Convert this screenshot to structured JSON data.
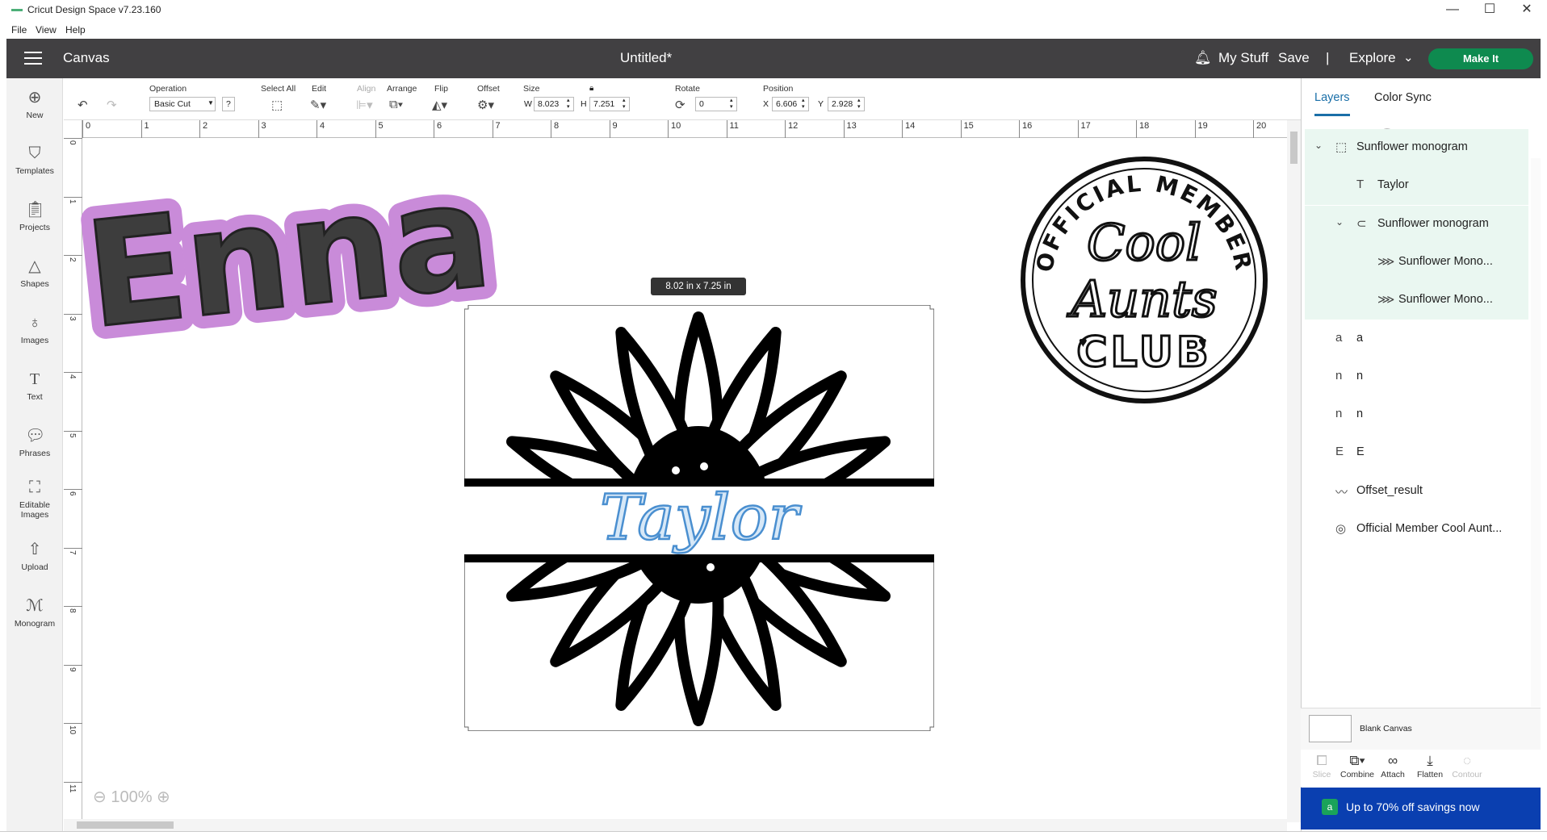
{
  "window": {
    "title": "Cricut Design Space  v7.23.160",
    "minimize": "—",
    "maximize": "☐",
    "close": "✕"
  },
  "menu": [
    "File",
    "View",
    "Help"
  ],
  "header": {
    "section": "Canvas",
    "doc_title": "Untitled*",
    "my_stuff": "My Stuff",
    "save": "Save",
    "divider": "|",
    "explore": "Explore",
    "make_it": "Make It"
  },
  "nav": [
    {
      "label": "New",
      "icon": "plus-circle-icon"
    },
    {
      "label": "Templates",
      "icon": "shirt-icon"
    },
    {
      "label": "Projects",
      "icon": "clipboard-icon"
    },
    {
      "label": "Shapes",
      "icon": "shapes-icon"
    },
    {
      "label": "Images",
      "icon": "lightbulb-icon"
    },
    {
      "label": "Text",
      "icon": "text-icon"
    },
    {
      "label": "Phrases",
      "icon": "speech-bubble-icon"
    },
    {
      "label": "Editable Images",
      "icon": "editable-image-icon"
    },
    {
      "label": "Upload",
      "icon": "upload-icon"
    },
    {
      "label": "Monogram",
      "icon": "monogram-icon"
    }
  ],
  "toolbar": {
    "operation_label": "Operation",
    "operation_value": "Basic Cut",
    "help": "?",
    "select_all": "Select All",
    "edit": "Edit",
    "align": "Align",
    "arrange": "Arrange",
    "flip": "Flip",
    "offset": "Offset",
    "size_label": "Size",
    "w_label": "W",
    "w_value": "8.023",
    "h_label": "H",
    "h_value": "7.251",
    "rotate_label": "Rotate",
    "rotate_value": "0",
    "position_label": "Position",
    "x_label": "X",
    "x_value": "6.606",
    "y_label": "Y",
    "y_value": "2.928"
  },
  "ruler_h": [
    "0",
    "1",
    "2",
    "3",
    "4",
    "5",
    "6",
    "7",
    "8",
    "9",
    "10",
    "11",
    "12",
    "13",
    "14",
    "15",
    "16",
    "17",
    "18",
    "19",
    "20"
  ],
  "ruler_v": [
    "0",
    "1",
    "2",
    "3",
    "4",
    "5",
    "6",
    "7",
    "8",
    "9",
    "10",
    "11"
  ],
  "canvas": {
    "size_badge": "8.02  in x 7.25  in",
    "zoom": "100%",
    "name_text": "Enna",
    "monogram_text": "Taylor",
    "badge_top": "OFFICIAL MEMBER",
    "badge_line1": "Cool",
    "badge_line2": "Aunts",
    "badge_bottom": "CLUB"
  },
  "panel": {
    "tab_layers": "Layers",
    "tab_colorsync": "Color Sync",
    "layers": [
      {
        "name": "Sunflower monogram",
        "level": 0,
        "group": true
      },
      {
        "name": "Taylor",
        "level": 1,
        "group": true
      },
      {
        "name": "Sunflower monogram",
        "level": 1,
        "group": true
      },
      {
        "name": "Sunflower Mono...",
        "level": 2,
        "group": true
      },
      {
        "name": "Sunflower Mono...",
        "level": 2,
        "group": true
      },
      {
        "name": "a",
        "level": 0,
        "group": false
      },
      {
        "name": "n",
        "level": 0,
        "group": false
      },
      {
        "name": "n",
        "level": 0,
        "group": false
      },
      {
        "name": "E",
        "level": 0,
        "group": false
      },
      {
        "name": "Offset_result",
        "level": 0,
        "group": false
      },
      {
        "name": "Official Member Cool Aunt...",
        "level": 0,
        "group": false
      }
    ],
    "blank_canvas": "Blank Canvas",
    "tools": {
      "slice": "Slice",
      "combine": "Combine",
      "attach": "Attach",
      "flatten": "Flatten",
      "contour": "Contour"
    },
    "promo": "Up to 70% off savings now"
  },
  "colors": {
    "header": "#414042",
    "make_it": "#0e8a4f",
    "accent": "#1a6fa8",
    "promo": "#0a3fb0",
    "enna_outline": "#c98bd9",
    "enna_fill": "#3d3d3d",
    "taylor": "#4a8fd0"
  }
}
